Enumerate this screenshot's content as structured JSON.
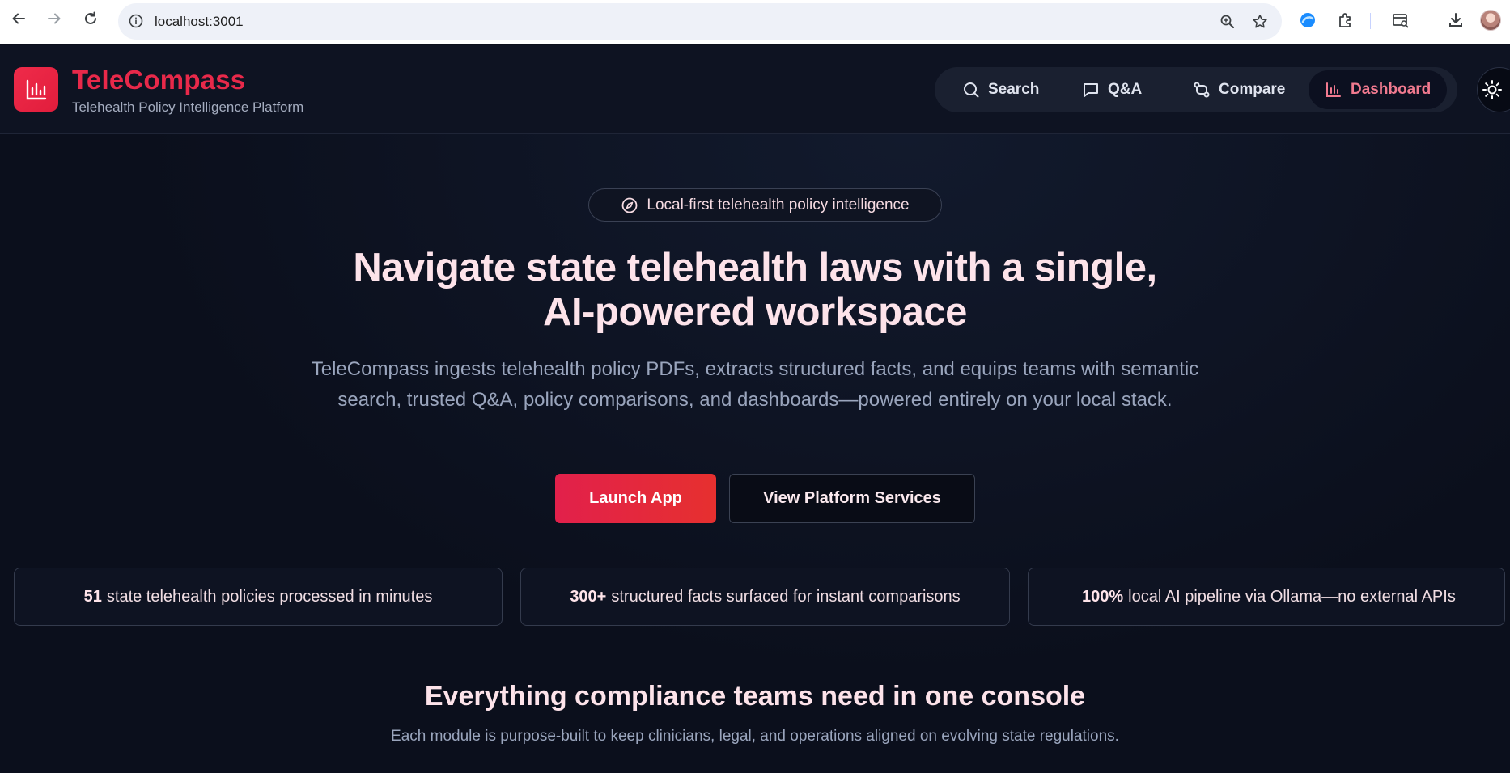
{
  "browser": {
    "url": "localhost:3001"
  },
  "header": {
    "brand_title": "TeleCompass",
    "brand_subtitle": "Telehealth Policy Intelligence Platform",
    "nav": [
      {
        "label": "Search",
        "icon": "search-icon"
      },
      {
        "label": "Q&A",
        "icon": "chat-icon"
      },
      {
        "label": "Compare",
        "icon": "compare-icon"
      },
      {
        "label": "Dashboard",
        "icon": "bar-chart-icon",
        "active": true
      }
    ]
  },
  "hero": {
    "badge": "Local-first telehealth policy intelligence",
    "title_line1": "Navigate state telehealth laws with a single,",
    "title_line2": "AI-powered workspace",
    "description": "TeleCompass ingests telehealth policy PDFs, extracts structured facts, and equips teams with semantic search, trusted Q&A, policy comparisons, and dashboards—powered entirely on your local stack.",
    "primary_button": "Launch App",
    "secondary_button": "View Platform Services"
  },
  "stats": [
    {
      "value": "51",
      "text": "state telehealth policies processed in minutes"
    },
    {
      "value": "300+",
      "text": "structured facts surfaced for instant comparisons"
    },
    {
      "value": "100%",
      "text": "local AI pipeline via Ollama—no external APIs"
    }
  ],
  "features": {
    "title": "Everything compliance teams need in one console",
    "description": "Each module is purpose-built to keep clinicians, legal, and operations aligned on evolving state regulations."
  },
  "colors": {
    "accent": "#e8294a",
    "background": "#0b0f1c",
    "nav_active_text": "#f17a8f"
  }
}
